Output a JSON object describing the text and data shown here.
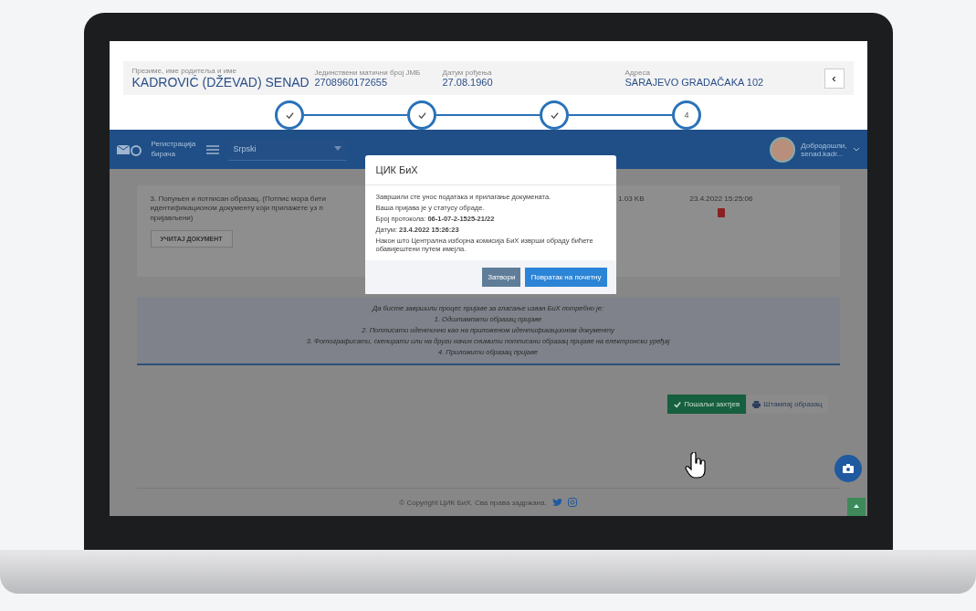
{
  "profile": {
    "fields": [
      {
        "label": "Презиме, име родитеља и име",
        "value": "KADROVIĆ (DŽEVAD) SENAD",
        "large": true
      },
      {
        "label": "Јединствени матични број ЈМБ",
        "value": "2708960172655",
        "large": false
      },
      {
        "label": "Датум рођења",
        "value": "27.08.1960",
        "large": false
      },
      {
        "label": "Адреса",
        "value": "SARAJEVO GRADAČAKA 102",
        "large": false
      }
    ],
    "collapse": "‹"
  },
  "steps": [
    {
      "done": true
    },
    {
      "done": true
    },
    {
      "done": true
    },
    {
      "done": false,
      "label": "4"
    }
  ],
  "navbar": {
    "title": "Регистрација бирача",
    "language": "Srpski",
    "greeting": "Добродошли,",
    "user": "senad.kadr..."
  },
  "document": {
    "text": "3. Попуњен и потписан образац. (Потпис мора бити идентификационом документу који прилажете уз п пријављени)",
    "upload": "УЧИТАЈ ДОКУМЕНТ",
    "size": "1.03 KB",
    "date": "23.4.2022 15:25:06"
  },
  "instructions": [
    "Да бисте завршили процес пријаве за гласање изван БиХ потребно је:",
    "1. Одштампати образац пријаве",
    "2. Потписати идентично као на приложеном идентификационом документу",
    "3. Фотографисати, скенирати или на други начин снимити потписани образац пријаве на електронски уређај",
    "4. Приложити образац пријаве"
  ],
  "actions": [
    {
      "kind": "submit",
      "label": "Пошаљи захтјев"
    },
    {
      "kind": "print",
      "label": "Штампај образац"
    }
  ],
  "footer": "© Copyright ЦИК БиХ. Сва права задржана.",
  "modal": {
    "title": "ЦИК БиХ",
    "lines": [
      "Завршили сте унос података и прилагање докумената.",
      "Ваша пријава је у статусу обраде.",
      "Број протокола: **06-1-07-2-1525-21/22**",
      "Датум: **23.4.2022 15:26:23**",
      "Након што Централна изборна комисија БиХ изврши обраду бићете обавијештени путем имејла."
    ],
    "buttons": [
      {
        "kind": "secondary",
        "label": "Затвори"
      },
      {
        "kind": "primary",
        "label": "Повратак на почетну"
      }
    ]
  }
}
